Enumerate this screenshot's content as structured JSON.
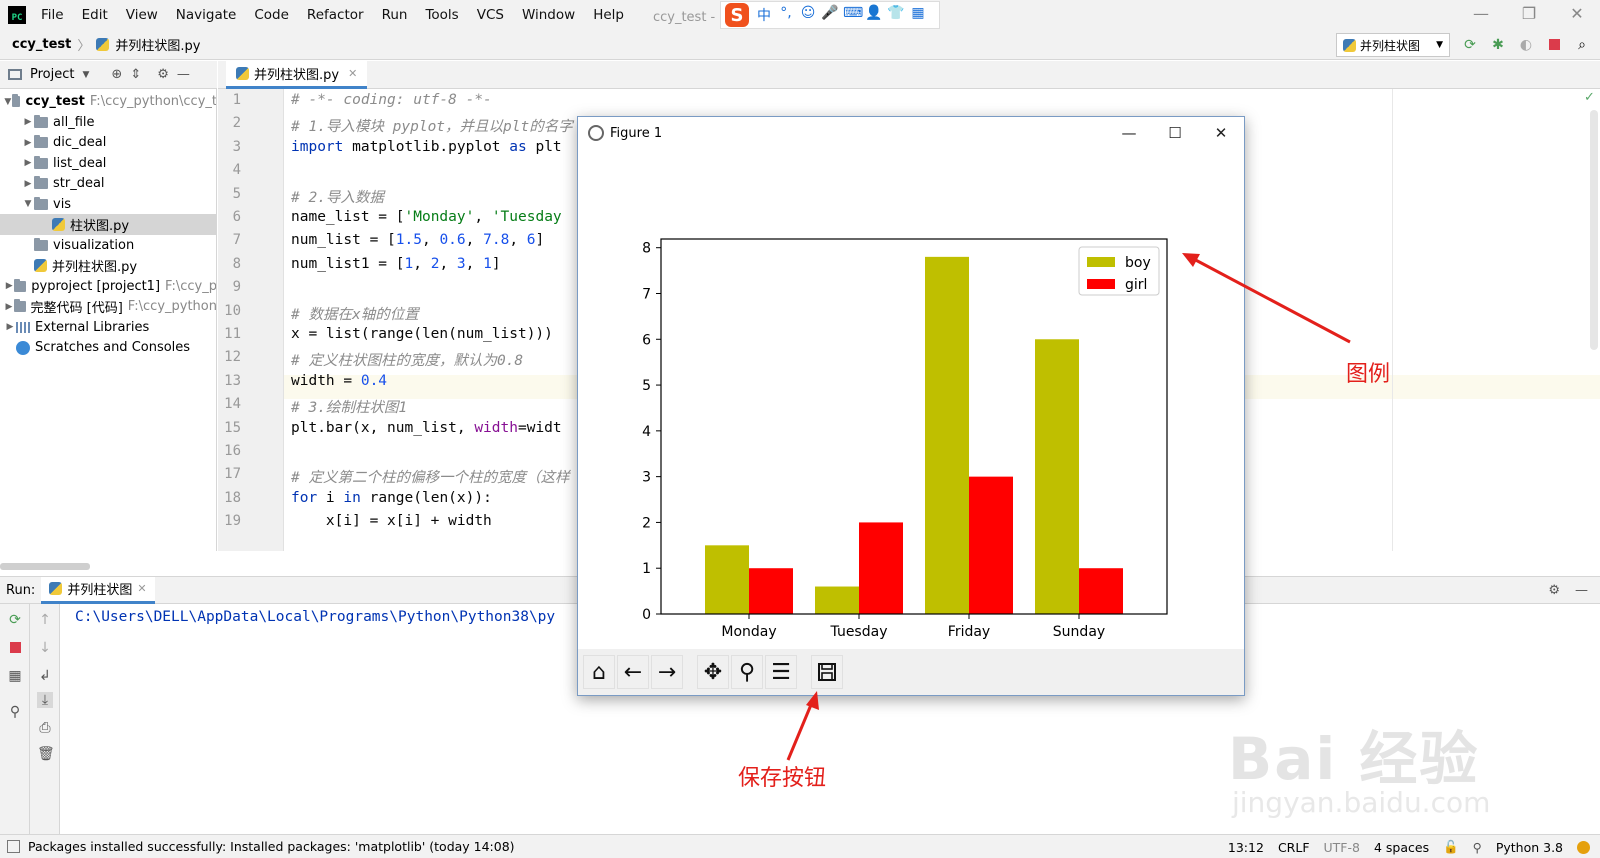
{
  "menubar": {
    "logo_text": "PC",
    "items": [
      "File",
      "Edit",
      "View",
      "Navigate",
      "Code",
      "Refactor",
      "Run",
      "Tools",
      "VCS",
      "Window",
      "Help"
    ],
    "window_title": "ccy_test - 并列柱状图.py [c",
    "ime": {
      "logo": "S",
      "buttons": [
        "中",
        "°,",
        "☺",
        "🎤",
        "⌨",
        "👤",
        "👕",
        "▦"
      ]
    }
  },
  "navbar": {
    "project": "ccy_test",
    "file": "并列柱状图.py",
    "run_config": "并列柱状图"
  },
  "project_panel": {
    "header": "Project",
    "tree": [
      {
        "name": "ccy_test",
        "hint": "F:\\ccy_python\\ccy_t",
        "indent": 0,
        "arrow": "▼",
        "type": "folder",
        "bold": true
      },
      {
        "name": "all_file",
        "hint": "",
        "indent": 1,
        "arrow": "▶",
        "type": "folder"
      },
      {
        "name": "dic_deal",
        "hint": "",
        "indent": 1,
        "arrow": "▶",
        "type": "folder"
      },
      {
        "name": "list_deal",
        "hint": "",
        "indent": 1,
        "arrow": "▶",
        "type": "folder"
      },
      {
        "name": "str_deal",
        "hint": "",
        "indent": 1,
        "arrow": "▶",
        "type": "folder"
      },
      {
        "name": "vis",
        "hint": "",
        "indent": 1,
        "arrow": "▼",
        "type": "folder"
      },
      {
        "name": "柱状图.py",
        "hint": "",
        "indent": 2,
        "arrow": "",
        "type": "py",
        "selected": true
      },
      {
        "name": "visualization",
        "hint": "",
        "indent": 1,
        "arrow": "",
        "type": "folder"
      },
      {
        "name": "并列柱状图.py",
        "hint": "",
        "indent": 1,
        "arrow": "",
        "type": "py"
      },
      {
        "name": "pyproject [project1]",
        "hint": "F:\\ccy_p",
        "indent": 0,
        "arrow": "▶",
        "type": "folder"
      },
      {
        "name": "完整代码 [代码]",
        "hint": "F:\\ccy_python",
        "indent": 0,
        "arrow": "▶",
        "type": "folder"
      },
      {
        "name": "External Libraries",
        "hint": "",
        "indent": 0,
        "arrow": "▶",
        "type": "libs"
      },
      {
        "name": "Scratches and Consoles",
        "hint": "",
        "indent": 0,
        "arrow": "",
        "type": "scratch"
      }
    ]
  },
  "editor": {
    "tab": "并列柱状图.py",
    "line_numbers": [
      "1",
      "2",
      "3",
      "4",
      "5",
      "6",
      "7",
      "8",
      "9",
      "10",
      "11",
      "12",
      "13",
      "14",
      "15",
      "16",
      "17",
      "18",
      "19"
    ],
    "lines": [
      "# -*- coding: utf-8 -*-",
      "# 1.导入模块 pyplot，并且以plt的名字",
      "import matplotlib.pyplot as plt",
      "",
      "# 2.导入数据",
      "name_list = ['Monday', 'Tuesday",
      "num_list = [1.5, 0.6, 7.8, 6]",
      "num_list1 = [1, 2, 3, 1]",
      "",
      "# 数据在x轴的位置",
      "x = list(range(len(num_list)))",
      "# 定义柱状图柱的宽度，默认为0.8",
      "width = 0.4",
      "# 3.绘制柱状图1",
      "plt.bar(x, num_list, width=widt",
      "",
      "# 定义第二个柱的偏移一个柱的宽度（这样",
      "for i in range(len(x)):",
      "    x[i] = x[i] + width"
    ]
  },
  "run_panel": {
    "label": "Run:",
    "tab": "并列柱状图",
    "console": "C:\\Users\\DELL\\AppData\\Local\\Programs\\Python\\Python38\\py"
  },
  "statusbar": {
    "message": "Packages installed successfully: Installed packages: 'matplotlib' (today 14:08)",
    "position": "13:12",
    "line_sep": "CRLF",
    "encoding": "UTF-8",
    "indent": "4 spaces",
    "interpreter": "Python 3.8"
  },
  "figure": {
    "title": "Figure 1",
    "toolbar": [
      "home-icon",
      "back-icon",
      "forward-icon",
      "pan-icon",
      "zoom-icon",
      "configure-icon",
      "save-icon"
    ]
  },
  "chart_data": {
    "type": "bar",
    "categories": [
      "Monday",
      "Tuesday",
      "Friday",
      "Sunday"
    ],
    "series": [
      {
        "name": "boy",
        "values": [
          1.5,
          0.6,
          7.8,
          6
        ],
        "color": "#bfbf00"
      },
      {
        "name": "girl",
        "values": [
          1,
          2,
          3,
          1
        ],
        "color": "#ff0000"
      }
    ],
    "yticks": [
      "0",
      "1",
      "2",
      "3",
      "4",
      "5",
      "6",
      "7",
      "8"
    ],
    "ylim": [
      0,
      8.19
    ],
    "legend": "top-right",
    "title": "",
    "xlabel": "",
    "ylabel": ""
  },
  "annotations": {
    "legend_label": "图例",
    "save_label": "保存按钮",
    "color": "#e3201b"
  },
  "watermark": {
    "text1": "Bai  经验",
    "text2": "jingyan.baidu.com"
  }
}
